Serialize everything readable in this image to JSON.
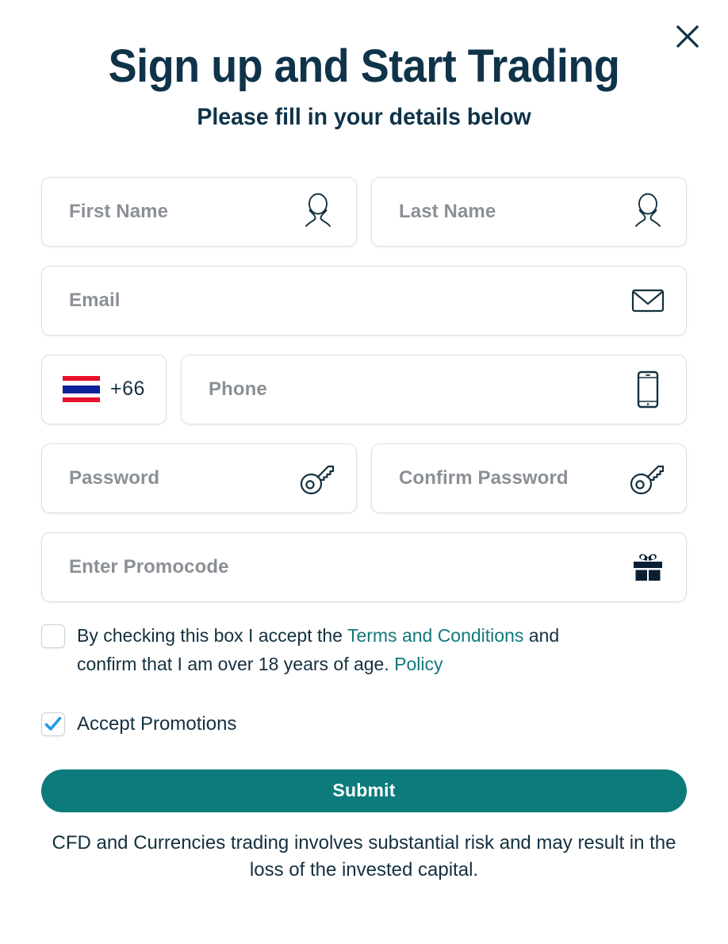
{
  "header": {
    "title": "Sign up and Start Trading",
    "subtitle": "Please fill in your details below",
    "close_icon": "close-icon"
  },
  "colors": {
    "title_navy": "#0f3349",
    "body_navy": "#14303f",
    "placeholder_grey": "#8b9096",
    "field_border": "#dcdfe2",
    "accent_teal": "#0d7b7b",
    "link_teal": "#11797c",
    "checkbox_check_blue": "#1f9ae8",
    "flag_red": "#e8112d",
    "flag_blue": "#0d2199"
  },
  "form": {
    "fields": [
      {
        "name": "first-name",
        "placeholder": "First Name",
        "value": "",
        "icon": "person-icon"
      },
      {
        "name": "last-name",
        "placeholder": "Last Name",
        "value": "",
        "icon": "person-icon"
      },
      {
        "name": "email",
        "placeholder": "Email",
        "value": "",
        "icon": "envelope-icon"
      },
      {
        "name": "phone",
        "placeholder": "Phone",
        "value": "",
        "icon": "smartphone-icon"
      },
      {
        "name": "password",
        "placeholder": "Password",
        "value": "",
        "icon": "key-icon"
      },
      {
        "name": "confirm-password",
        "placeholder": "Confirm Password",
        "value": "",
        "icon": "key-icon"
      },
      {
        "name": "promocode",
        "placeholder": "Enter Promocode",
        "value": "",
        "icon": "gift-icon"
      }
    ],
    "country": {
      "dial_code": "+66",
      "flag": "thailand-flag",
      "flag_name": "Thailand"
    }
  },
  "terms": {
    "checked": false,
    "text_part1": "By checking this box I accept the ",
    "link1": "Terms and Conditions",
    "text_part2": " and confirm that I am over 18 years of age. ",
    "link2": "Policy"
  },
  "promotions": {
    "checked": true,
    "label": "Accept Promotions"
  },
  "submit": {
    "label": "Submit"
  },
  "disclaimer": {
    "text": "CFD and Currencies trading involves substantial risk and may result in the loss of the invested capital."
  }
}
